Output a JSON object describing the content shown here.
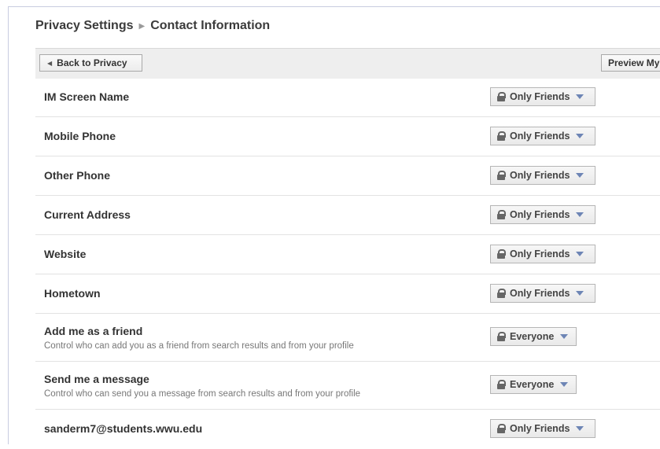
{
  "breadcrumb": {
    "parent": "Privacy Settings",
    "current": "Contact Information"
  },
  "toolbar": {
    "back_label": "Back to Privacy",
    "preview_label": "Preview My Profile"
  },
  "rows": [
    {
      "label": "IM Screen Name",
      "setting": "Only Friends"
    },
    {
      "label": "Mobile Phone",
      "setting": "Only Friends"
    },
    {
      "label": "Other Phone",
      "setting": "Only Friends"
    },
    {
      "label": "Current Address",
      "setting": "Only Friends"
    },
    {
      "label": "Website",
      "setting": "Only Friends"
    },
    {
      "label": "Hometown",
      "setting": "Only Friends"
    },
    {
      "label": "Add me as a friend",
      "description": "Control who can add you as a friend from search results and from your profile",
      "setting": "Everyone"
    },
    {
      "label": "Send me a message",
      "description": "Control who can send you a message from search results and from your profile",
      "setting": "Everyone"
    },
    {
      "label": "sanderm7@students.wwu.edu",
      "setting": "Only Friends"
    }
  ]
}
